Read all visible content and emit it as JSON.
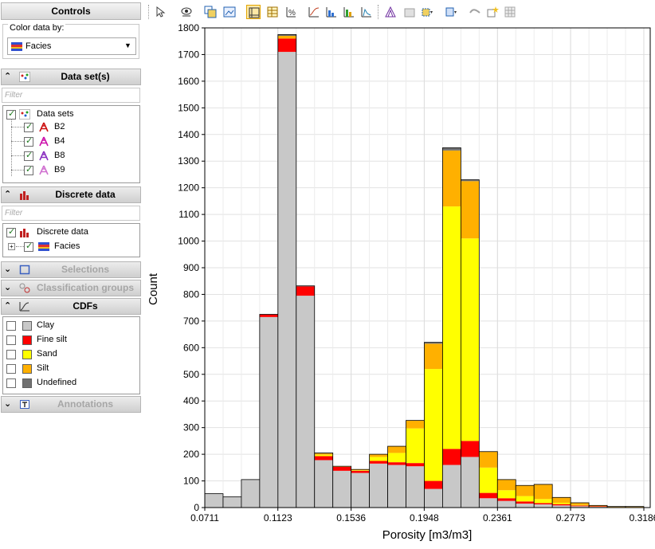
{
  "controls": {
    "title": "Controls",
    "color_by_label": "Color data by:",
    "color_by_value": "Facies"
  },
  "sections": {
    "datasets": {
      "title": "Data set(s)",
      "expanded": true,
      "filter_placeholder": "Filter"
    },
    "discrete": {
      "title": "Discrete data",
      "expanded": true,
      "filter_placeholder": "Filter"
    },
    "selections": {
      "title": "Selections",
      "expanded": false
    },
    "classification": {
      "title": "Classification groups",
      "expanded": false
    },
    "cdfs": {
      "title": "CDFs",
      "expanded": true
    },
    "annotations": {
      "title": "Annotations",
      "expanded": false
    }
  },
  "datasets_tree": {
    "root": "Data sets",
    "items": [
      {
        "label": "B2",
        "color": "#cc1010"
      },
      {
        "label": "B4",
        "color": "#cc10aa"
      },
      {
        "label": "B8",
        "color": "#8a30c0"
      },
      {
        "label": "B9",
        "color": "#d070d0"
      }
    ]
  },
  "discrete_tree": {
    "root": "Discrete data",
    "child": "Facies"
  },
  "cdf_items": [
    {
      "label": "Clay",
      "color": "#c8c8c8"
    },
    {
      "label": "Fine silt",
      "color": "#ff0000"
    },
    {
      "label": "Sand",
      "color": "#ffff00"
    },
    {
      "label": "Silt",
      "color": "#ffb000"
    },
    {
      "label": "Undefined",
      "color": "#707070"
    }
  ],
  "toolbar": {
    "icons": [
      "pointer-icon",
      "eye-icon",
      "copy-image-icon",
      "export-image-icon",
      "frame-icon",
      "table-icon",
      "percent-icon",
      "cdf-icon",
      "hist-icon",
      "stacked-hist-icon",
      "hist-lines-icon",
      "shape-icon",
      "shape-gray-icon",
      "cube-icon",
      "cube-grid-icon",
      "wave-icon",
      "star-icon",
      "grid-gray-icon"
    ]
  },
  "chart_data": {
    "type": "bar",
    "stacked": true,
    "xlabel": "Porosity [m3/m3]",
    "ylabel": "Count",
    "ylim": [
      0,
      1800
    ],
    "yticks": [
      0,
      100,
      200,
      300,
      400,
      500,
      600,
      700,
      800,
      900,
      1000,
      1100,
      1200,
      1300,
      1400,
      1500,
      1600,
      1700,
      1800
    ],
    "xtick_labels": [
      "0.0711",
      "0.1123",
      "0.1536",
      "0.1948",
      "0.2361",
      "0.2773",
      "0.3186"
    ],
    "xlim": [
      0.0711,
      0.3222
    ],
    "bin_start": 0.0711,
    "bin_width": 0.010312,
    "grid": true,
    "series": [
      {
        "name": "Clay",
        "color": "#c8c8c8",
        "values": [
          52,
          40,
          105,
          715,
          1710,
          795,
          178,
          138,
          130,
          165,
          160,
          155,
          70,
          160,
          190,
          35,
          25,
          15,
          12,
          8,
          5,
          3,
          2,
          2
        ]
      },
      {
        "name": "Fine silt",
        "color": "#ff0000",
        "values": [
          0,
          0,
          0,
          10,
          50,
          35,
          15,
          15,
          8,
          10,
          10,
          12,
          30,
          60,
          60,
          20,
          10,
          8,
          5,
          5,
          3,
          2,
          0,
          0
        ]
      },
      {
        "name": "Sand",
        "color": "#ffff00",
        "values": [
          0,
          0,
          0,
          0,
          0,
          0,
          5,
          0,
          2,
          15,
          35,
          130,
          420,
          910,
          760,
          95,
          30,
          20,
          15,
          5,
          2,
          0,
          0,
          0
        ]
      },
      {
        "name": "Silt",
        "color": "#ffb000",
        "values": [
          0,
          0,
          0,
          0,
          10,
          0,
          5,
          2,
          3,
          10,
          25,
          30,
          95,
          210,
          215,
          60,
          40,
          40,
          55,
          20,
          8,
          3,
          2,
          2
        ]
      },
      {
        "name": "Undefined",
        "color": "#707070",
        "values": [
          0,
          0,
          0,
          0,
          5,
          2,
          2,
          0,
          0,
          0,
          0,
          0,
          5,
          10,
          5,
          0,
          0,
          0,
          0,
          0,
          0,
          0,
          0,
          0
        ]
      }
    ]
  }
}
